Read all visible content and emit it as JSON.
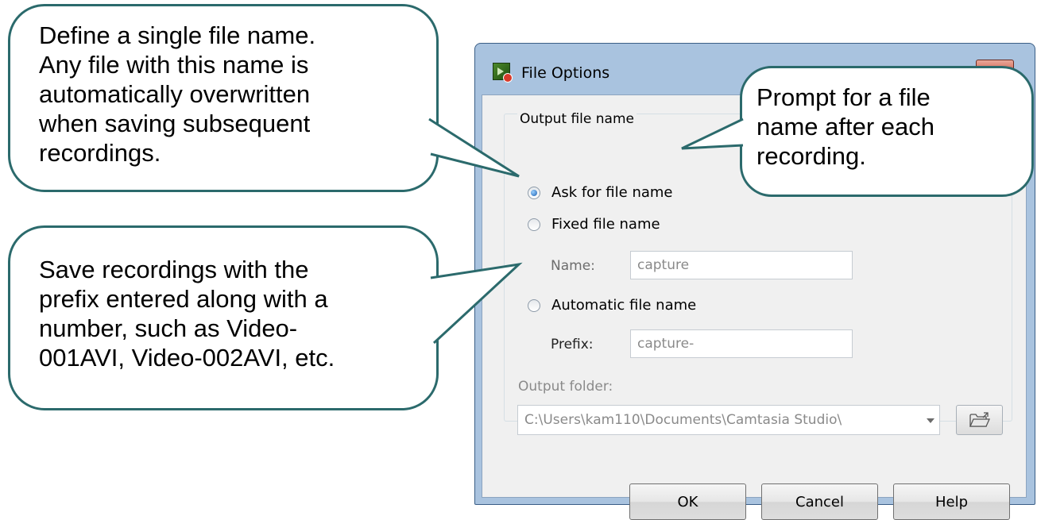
{
  "dialog": {
    "title": "File Options",
    "group_label": "Output file name",
    "options": [
      {
        "label": "Ask for file name",
        "checked": true
      },
      {
        "label": "Fixed file name",
        "checked": false
      },
      {
        "label": "Automatic file name",
        "checked": false
      }
    ],
    "name_label": "Name:",
    "name_value": "capture",
    "prefix_label": "Prefix:",
    "prefix_value": "capture-",
    "folder_label": "Output folder:",
    "folder_value": "C:\\Users\\kam110\\Documents\\Camtasia Studio\\",
    "buttons": {
      "ok": "OK",
      "cancel": "Cancel",
      "help": "Help"
    }
  },
  "callouts": {
    "fixed": "Define a single file name.\nAny file with this name is\nautomatically overwritten\nwhen saving subsequent\nrecordings.",
    "ask": "Prompt for a file\nname after each\nrecording.",
    "automatic": "Save recordings with the\nprefix entered along with a\nnumber, such as Video-\n001AVI, Video-002AVI, etc."
  },
  "colors": {
    "callout_border": "#2b6a6c",
    "window_frame": "#a9c3df",
    "close_button": "#c8402a",
    "radio_selected": "#1b5fb0"
  },
  "icons": [
    "app-icon",
    "close-icon",
    "dropdown-arrow-icon",
    "folder-open-icon"
  ]
}
